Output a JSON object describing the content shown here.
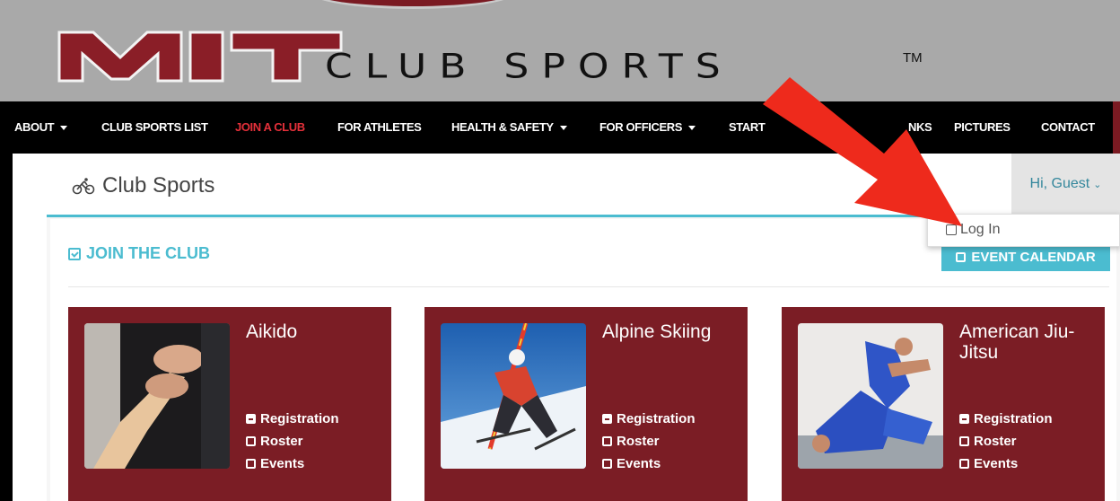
{
  "header": {
    "logo_mit": "MIT",
    "logo_club": "CLUB SPORTS",
    "logo_tm": "TM",
    "brand_color": "#7a1a22"
  },
  "nav": {
    "items": [
      {
        "label": "ABOUT",
        "dropdown": true
      },
      {
        "label": "CLUB SPORTS LIST",
        "dropdown": false
      },
      {
        "label": "JOIN A CLUB",
        "dropdown": false,
        "active": true
      },
      {
        "label": "FOR ATHLETES",
        "dropdown": false
      },
      {
        "label": "HEALTH & SAFETY",
        "dropdown": true
      },
      {
        "label": "FOR OFFICERS",
        "dropdown": true
      },
      {
        "label": "START",
        "dropdown": false
      },
      {
        "label": "NKS",
        "dropdown": false
      },
      {
        "label": "PICTURES",
        "dropdown": false
      },
      {
        "label": "CONTACT",
        "dropdown": false
      }
    ],
    "active_color": "#e5303a"
  },
  "subbar": {
    "title": "Club Sports",
    "title_icon": "bicycle-icon",
    "user_menu_label": "Hi, Guest",
    "accent": "#4bbcd0"
  },
  "user_dropdown": {
    "items": [
      {
        "label": "Log In",
        "icon": "sign-in-icon"
      }
    ]
  },
  "main": {
    "section_title": "JOIN THE CLUB",
    "event_calendar_label": "EVENT CALENDAR",
    "cards": [
      {
        "name": "Aikido",
        "links": [
          "Registration",
          "Roster",
          "Events"
        ]
      },
      {
        "name": "Alpine Skiing",
        "links": [
          "Registration",
          "Roster",
          "Events"
        ]
      },
      {
        "name": "American Jiu-Jitsu",
        "links": [
          "Registration",
          "Roster",
          "Events"
        ]
      }
    ],
    "card_color": "#7b1d25"
  },
  "annotation": {
    "arrow_color": "#ee2a1c"
  }
}
